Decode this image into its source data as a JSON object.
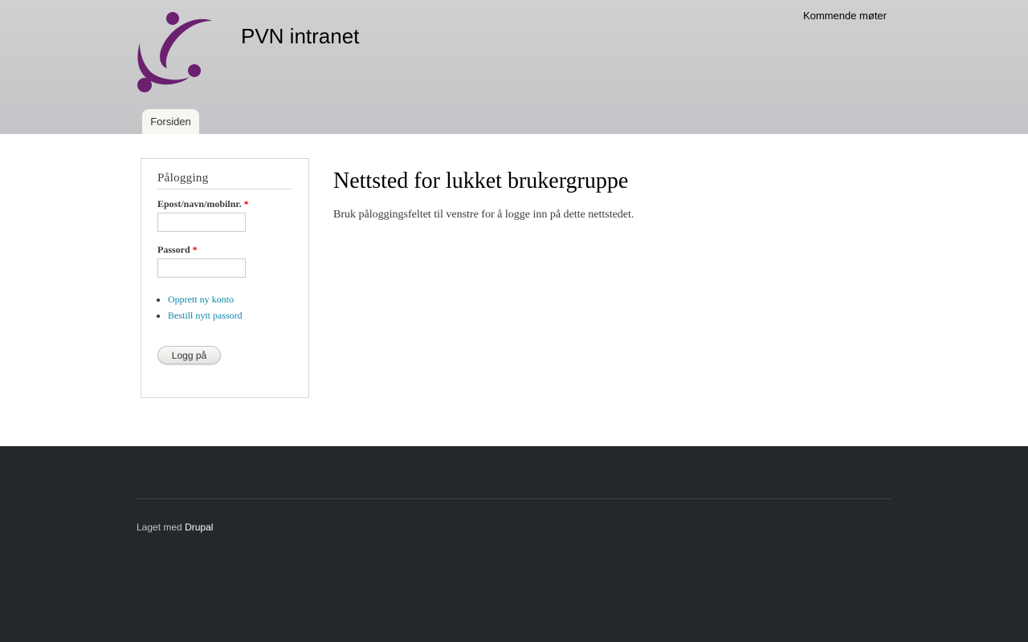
{
  "header": {
    "site_name": "PVN intranet",
    "secondary_menu": "Kommende møter",
    "main_menu": [
      "Forsiden"
    ],
    "logo_color": "#6b2070"
  },
  "login": {
    "title": "Pålogging",
    "username_label": "Epost/navn/mobilnr.",
    "password_label": "Passord",
    "required_marker": "*",
    "username_value": "",
    "password_value": "",
    "links": [
      "Opprett ny konto",
      "Bestill nytt passord"
    ],
    "submit_label": "Logg på"
  },
  "main": {
    "title": "Nettsted for lukket brukergruppe",
    "body": "Bruk påloggingsfeltet til venstre for å logge inn på dette nettstedet."
  },
  "footer": {
    "prefix": "Laget med",
    "link": "Drupal"
  },
  "colors": {
    "link": "#0a86a9",
    "footer_bg": "#24272c",
    "required": "#ee0000"
  }
}
